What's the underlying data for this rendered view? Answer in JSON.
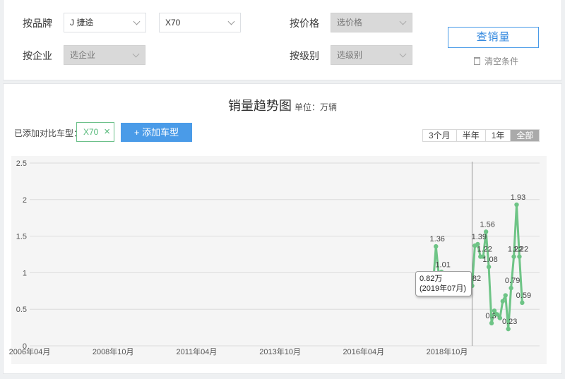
{
  "filters": {
    "brand_label": "按品牌",
    "brand_value": "J 捷途",
    "model_value": "X70",
    "company_label": "按企业",
    "company_placeholder": "选企业",
    "price_label": "按价格",
    "price_placeholder": "选价格",
    "level_label": "按级别",
    "level_placeholder": "选级别",
    "query_button": "查销量",
    "clear_link": "清空条件"
  },
  "chart_header": {
    "title": "销量趋势图",
    "unit": "单位：万辆"
  },
  "compare": {
    "label": "已添加对比车型：",
    "tag": "X70",
    "tag_close": "×",
    "add_button": "+ 添加车型"
  },
  "ranges": [
    {
      "label": "3个月",
      "active": false
    },
    {
      "label": "半年",
      "active": false
    },
    {
      "label": "1年",
      "active": false
    },
    {
      "label": "全部",
      "active": true
    }
  ],
  "tooltip": {
    "value": "0.82万",
    "date": "(2019年07月)"
  },
  "colors": {
    "series": "#6ec486",
    "accent": "#4a9be8"
  },
  "chart_data": {
    "type": "line",
    "title": "销量趋势图",
    "ylabel": "",
    "xlabel": "",
    "ylim": [
      0,
      2.5
    ],
    "xlim": [
      "2006-04",
      "2020-12"
    ],
    "yticks": [
      "0",
      "0.5",
      "1",
      "1.5",
      "2",
      "2.5"
    ],
    "xticks": [
      {
        "date": "2006-04",
        "label": "2006年04月"
      },
      {
        "date": "2008-10",
        "label": "2008年10月"
      },
      {
        "date": "2011-04",
        "label": "2011年04月"
      },
      {
        "date": "2013-10",
        "label": "2013年10月"
      },
      {
        "date": "2016-04",
        "label": "2016年04月"
      },
      {
        "date": "2018-10",
        "label": "2018年10月"
      }
    ],
    "grid": true,
    "crosshair_date": "2019-07",
    "series": [
      {
        "name": "X70",
        "points": [
          {
            "date": "2018-05",
            "value": 0.85
          },
          {
            "date": "2018-06",
            "value": 1.36,
            "label": "1.36"
          },
          {
            "date": "2018-07",
            "value": 0.98
          },
          {
            "date": "2018-08",
            "value": 1.01,
            "label": "1.01"
          },
          {
            "date": "2018-09",
            "value": 0.91
          },
          {
            "date": "2018-10",
            "value": 0.85
          },
          {
            "date": "2018-11",
            "value": 0.82
          },
          {
            "date": "2018-12",
            "value": 0.82
          },
          {
            "date": "2019-01",
            "value": 0.82
          },
          {
            "date": "2019-02",
            "value": 0.82
          },
          {
            "date": "2019-03",
            "value": 0.82
          },
          {
            "date": "2019-04",
            "value": 0.82
          },
          {
            "date": "2019-05",
            "value": 0.82
          },
          {
            "date": "2019-06",
            "value": 0.82
          },
          {
            "date": "2019-07",
            "value": 0.82,
            "label": "0.82"
          },
          {
            "date": "2019-08",
            "value": 1.37
          },
          {
            "date": "2019-09",
            "value": 1.39,
            "label": "1.39"
          },
          {
            "date": "2019-10",
            "value": 1.22
          },
          {
            "date": "2019-11",
            "value": 1.22,
            "label": "1.22"
          },
          {
            "date": "2019-12",
            "value": 1.56,
            "label": "1.56"
          },
          {
            "date": "2020-01",
            "value": 1.08,
            "label": "1.08"
          },
          {
            "date": "2020-02",
            "value": 0.31,
            "label": "0.31"
          },
          {
            "date": "2020-03",
            "value": 0.48
          },
          {
            "date": "2020-04",
            "value": 0.43
          },
          {
            "date": "2020-05",
            "value": 0.38
          },
          {
            "date": "2020-06",
            "value": 0.61
          },
          {
            "date": "2020-07",
            "value": 0.69
          },
          {
            "date": "2020-08",
            "value": 0.23,
            "label": "0.23"
          },
          {
            "date": "2020-09",
            "value": 0.79,
            "label": "0.79"
          },
          {
            "date": "2020-10",
            "value": 1.22,
            "label": "1.22"
          },
          {
            "date": "2020-11",
            "value": 1.93,
            "label": "1.93"
          },
          {
            "date": "2020-12",
            "value": 1.22,
            "label": "1.22"
          },
          {
            "date": "2021-01",
            "value": 0.59,
            "label": "0.59"
          }
        ]
      }
    ]
  }
}
